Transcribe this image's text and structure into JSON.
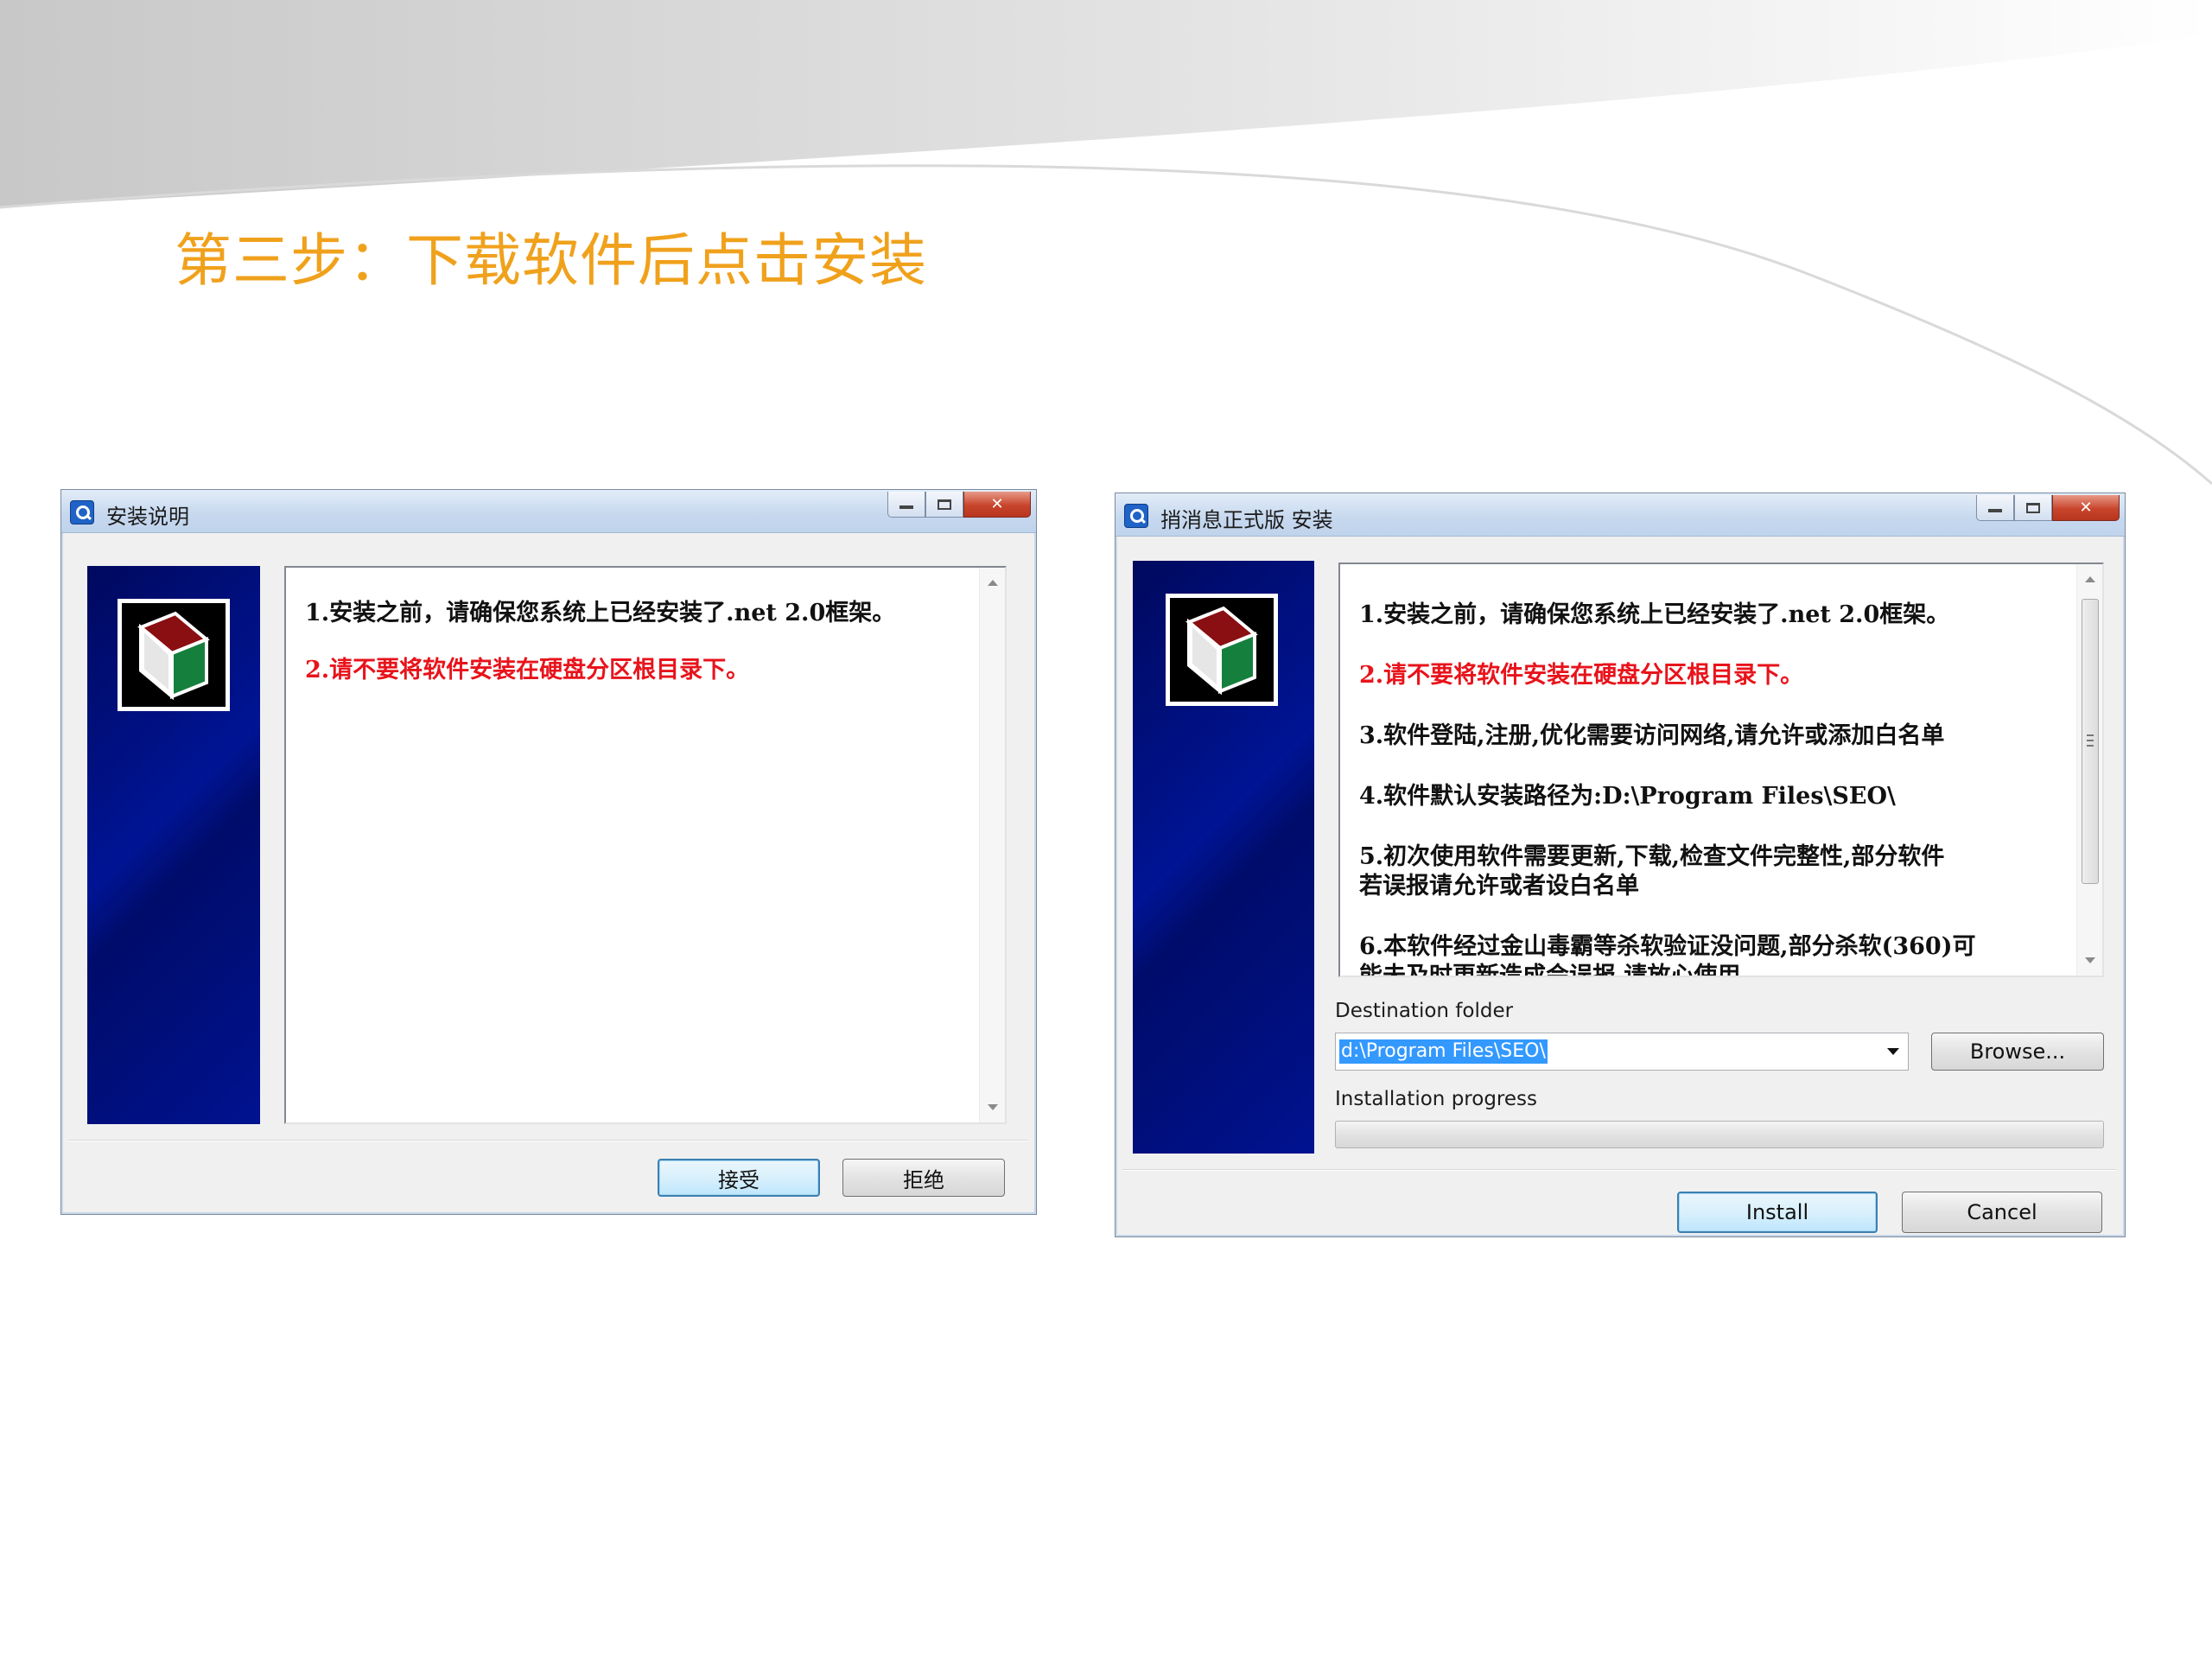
{
  "slide": {
    "title": "第三步：下载软件后点击安装"
  },
  "colors": {
    "title_orange": "#f0a11c",
    "banner_navy": "#000f78",
    "warning_red": "#e8131b"
  },
  "dialog1": {
    "title": "安装说明",
    "icon": "app-search-icon",
    "lines": [
      "1.安装之前，请确保您系统上已经安装了.net 2.0框架。",
      "2.请不要将软件安装在硬盘分区根目录下。"
    ],
    "accept_label": "接受",
    "reject_label": "拒绝"
  },
  "dialog2": {
    "title": "捎消息正式版 安装",
    "icon": "app-search-icon",
    "lines": [
      "1.安装之前，请确保您系统上已经安装了.net 2.0框架。",
      "2.请不要将软件安装在硬盘分区根目录下。",
      "3.软件登陆,注册,优化需要访问网络,请允许或添加白名单",
      "4.软件默认安装路径为:D:\\Program Files\\SEO\\",
      "5.初次使用软件需要更新,下载,检查文件完整性,部分软件",
      "若误报请允许或者设白名单",
      "6.本软件经过金山毒霸等杀软验证没问题,部分杀软(360)可",
      "能未及时更新造成会误报,请放心使用"
    ],
    "destination_label": "Destination folder",
    "destination_value": "d:\\Program Files\\SEO\\",
    "browse_label": "Browse...",
    "progress_label": "Installation progress",
    "progress": 0,
    "install_label": "Install",
    "cancel_label": "Cancel"
  }
}
